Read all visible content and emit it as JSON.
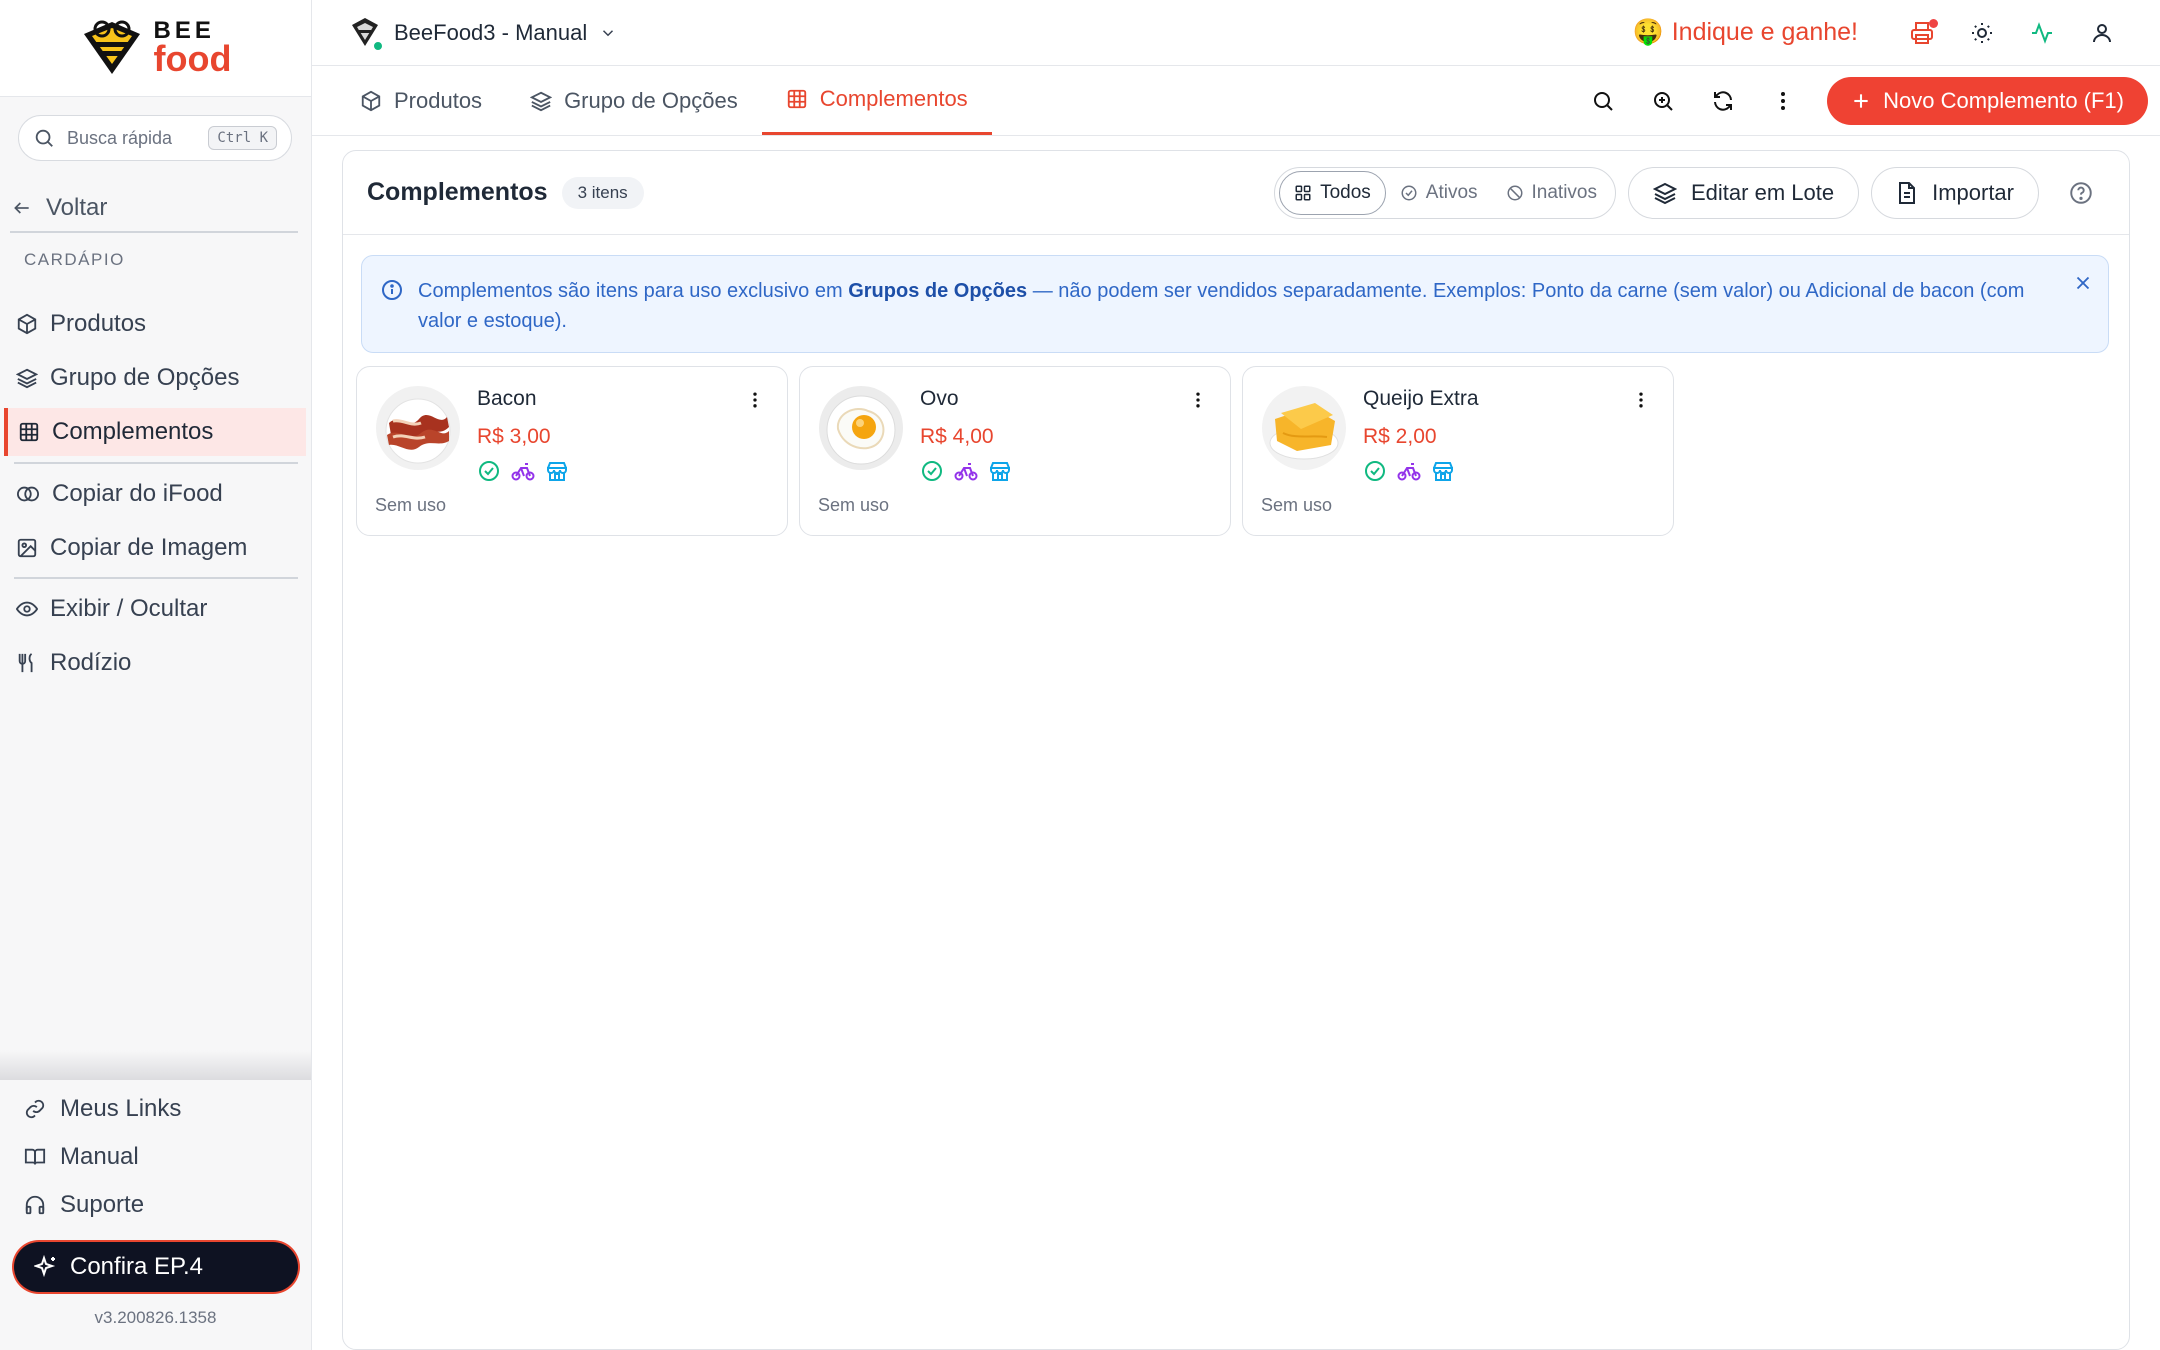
{
  "brand": {
    "line1": "BEE",
    "line2": "food"
  },
  "search": {
    "placeholder": "Busca rápida",
    "shortcut": "Ctrl K"
  },
  "sidebar": {
    "back_label": "Voltar",
    "section": "CARDÁPIO",
    "items": [
      {
        "label": "Produtos",
        "icon": "box-icon"
      },
      {
        "label": "Grupo de Opções",
        "icon": "layers-icon"
      },
      {
        "label": "Complementos",
        "icon": "grid-icon",
        "active": true
      },
      {
        "label": "Copiar do iFood",
        "icon": "copy-icon"
      },
      {
        "label": "Copiar de Imagem",
        "icon": "image-icon"
      },
      {
        "label": "Exibir / Ocultar",
        "icon": "eye-icon"
      },
      {
        "label": "Rodízio",
        "icon": "utensils-icon"
      }
    ],
    "bottom": [
      {
        "label": "Meus Links",
        "icon": "link-icon"
      },
      {
        "label": "Manual",
        "icon": "book-icon"
      },
      {
        "label": "Suporte",
        "icon": "headset-icon"
      }
    ],
    "cta_label": "Confira EP.4",
    "version": "v3.200826.1358"
  },
  "topbar": {
    "store_name": "BeeFood3 - Manual",
    "refer_label": "Indique e ganhe!",
    "refer_emoji": "🤑"
  },
  "tabs": [
    {
      "label": "Produtos"
    },
    {
      "label": "Grupo de Opções"
    },
    {
      "label": "Complementos",
      "active": true
    }
  ],
  "new_button_label": "Novo Complemento (F1)",
  "panel": {
    "title": "Complementos",
    "count": "3 itens",
    "filters": [
      {
        "label": "Todos",
        "active": true
      },
      {
        "label": "Ativos"
      },
      {
        "label": "Inativos"
      }
    ],
    "batch_label": "Editar em Lote",
    "import_label": "Importar"
  },
  "info": {
    "part1": "Complementos são itens para uso exclusivo em ",
    "bold": "Grupos de Opções",
    "part2": " — não podem ser vendidos separadamente. Exemplos: Ponto da carne (sem valor) ou Adicional de bacon (com valor e estoque)."
  },
  "items": [
    {
      "name": "Bacon",
      "price": "R$ 3,00",
      "usage": "Sem uso"
    },
    {
      "name": "Ovo",
      "price": "R$ 4,00",
      "usage": "Sem uso"
    },
    {
      "name": "Queijo Extra",
      "price": "R$ 2,00",
      "usage": "Sem uso"
    }
  ],
  "colors": {
    "accent": "#e8462f",
    "info_text": "#2f67c6",
    "info_bg": "#eef5ff",
    "ok": "#10b981",
    "delivery": "#9333ea",
    "store": "#0ea5e9"
  }
}
